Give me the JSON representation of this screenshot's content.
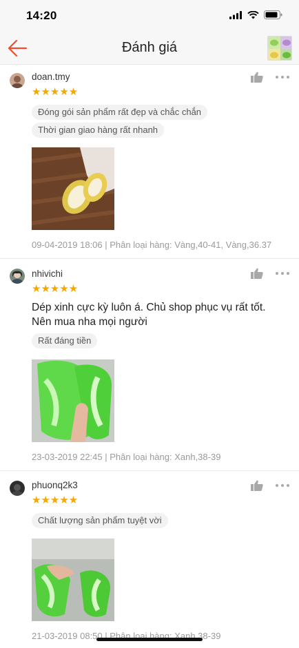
{
  "status_bar": {
    "time": "14:20"
  },
  "header": {
    "title": "Đánh giá"
  },
  "reviews": [
    {
      "username": "doan.tmy",
      "stars": "★★★★★",
      "rating": 5,
      "tags": [
        "Đóng gói sản phẩm rất đẹp và chắc chắn",
        "Thời gian giao hàng rất nhanh"
      ],
      "comment": "",
      "meta": "09-04-2019 18:06 | Phân loại hàng: Vàng,40-41, Vàng,36.37"
    },
    {
      "username": "nhivichi",
      "stars": "★★★★★",
      "rating": 5,
      "comment": "Dép xinh cực kỳ luôn á. Chủ shop phục vụ rất tốt. Nên mua nha mọi người",
      "tags": [
        "Rất đáng tiền"
      ],
      "meta": "23-03-2019 22:45 | Phân loại hàng: Xanh,38-39"
    },
    {
      "username": "phuonq2k3",
      "stars": "★★★★★",
      "rating": 5,
      "tags": [
        "Chất lượng sản phẩm tuyệt vời"
      ],
      "comment": "",
      "meta": "21-03-2019 08:50 | Phân loại hàng: Xanh,38-39"
    }
  ],
  "colors": {
    "accent": "#ee4d2d",
    "star": "#f6a700"
  }
}
